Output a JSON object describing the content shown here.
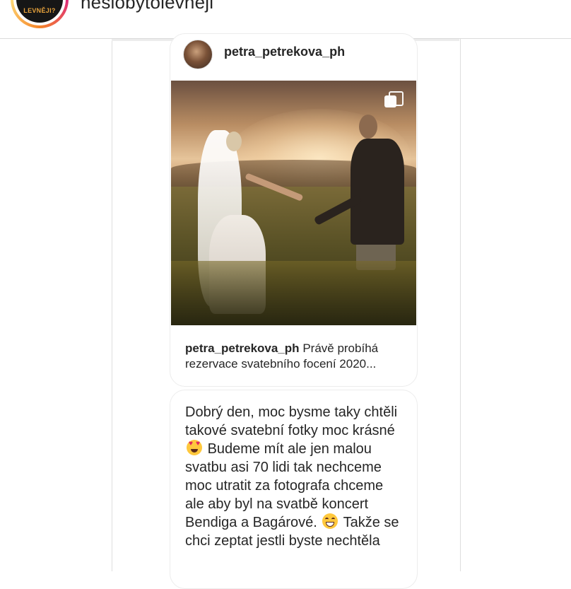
{
  "header": {
    "account_name": "neslobytolevněji",
    "profile_text": "LEVNĚJI?"
  },
  "shared_post": {
    "username": "petra_petrekova_ph",
    "caption_user": "petra_petrekova_ph",
    "caption_text": "Právě probíhá rezervace svatebního focení 2020...",
    "carousel_icon": "multiple-photos-icon"
  },
  "message": {
    "line1": "Dobrý den, moc bysme taky chtěli takové svatební fotky moc krásné",
    "emoji1": "heart-eyes-emoji",
    "line2": "Budeme mít ale jen malou svatbu asi 70 lidi tak nechceme moc utratit za fotografa chceme ale aby byl na svatbě koncert Bendiga a Bagárové.",
    "emoji2": "grinning-emoji",
    "line3": "Takže se chci zeptat jestli byste nechtěla"
  }
}
